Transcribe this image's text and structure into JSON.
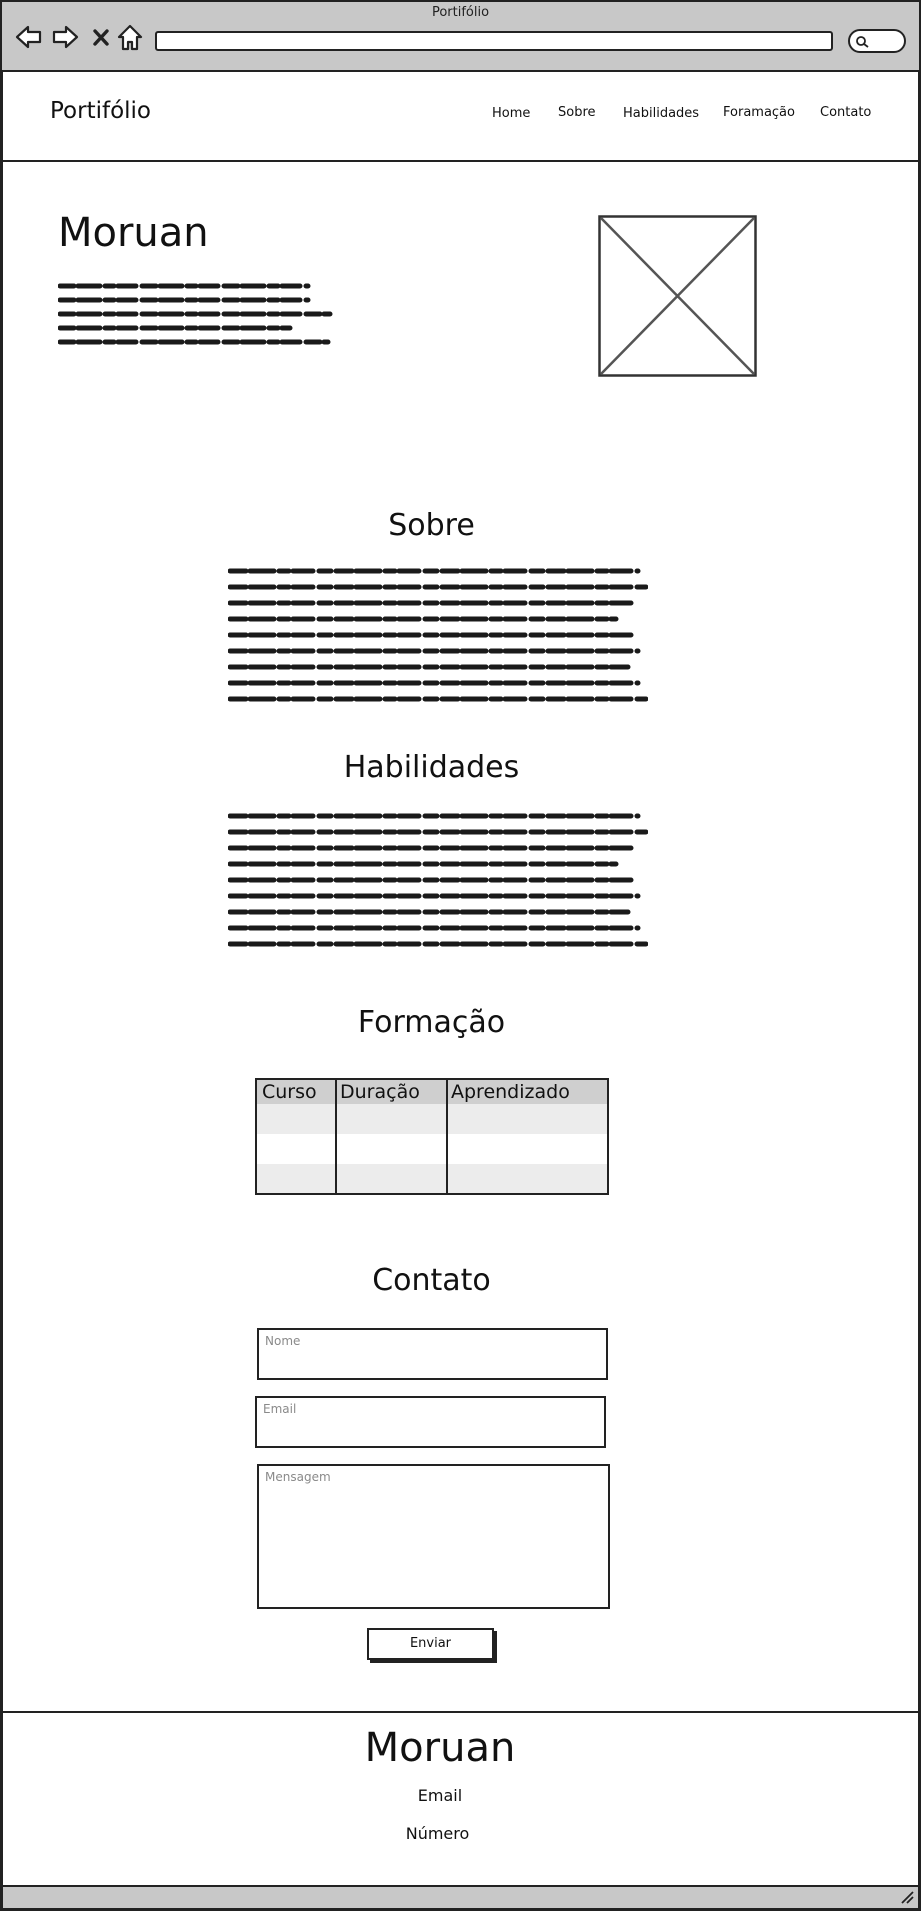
{
  "browser": {
    "title": "Portifólio"
  },
  "header": {
    "brand": "Portifólio",
    "nav": [
      "Home",
      "Sobre",
      "Habilidades",
      "Foramação",
      "Contato"
    ]
  },
  "hero": {
    "name": "Moruan"
  },
  "sections": {
    "sobre": "Sobre",
    "habilidades": "Habilidades",
    "formacao": "Formação",
    "contato": "Contato"
  },
  "table": {
    "headers": [
      "Curso",
      "Duração",
      "Aprendizado"
    ]
  },
  "form": {
    "name_placeholder": "Nome",
    "email_placeholder": "Email",
    "message_placeholder": "Mensagem",
    "submit_label": "Enviar"
  },
  "footer": {
    "name": "Moruan",
    "email": "Email",
    "number": "Número"
  },
  "colors": {
    "ink": "#222222",
    "chrome": "#c8c8c8",
    "header_row": "#cfcfcf",
    "stripe": "#ececec",
    "placeholder": "#8a8a8a"
  }
}
